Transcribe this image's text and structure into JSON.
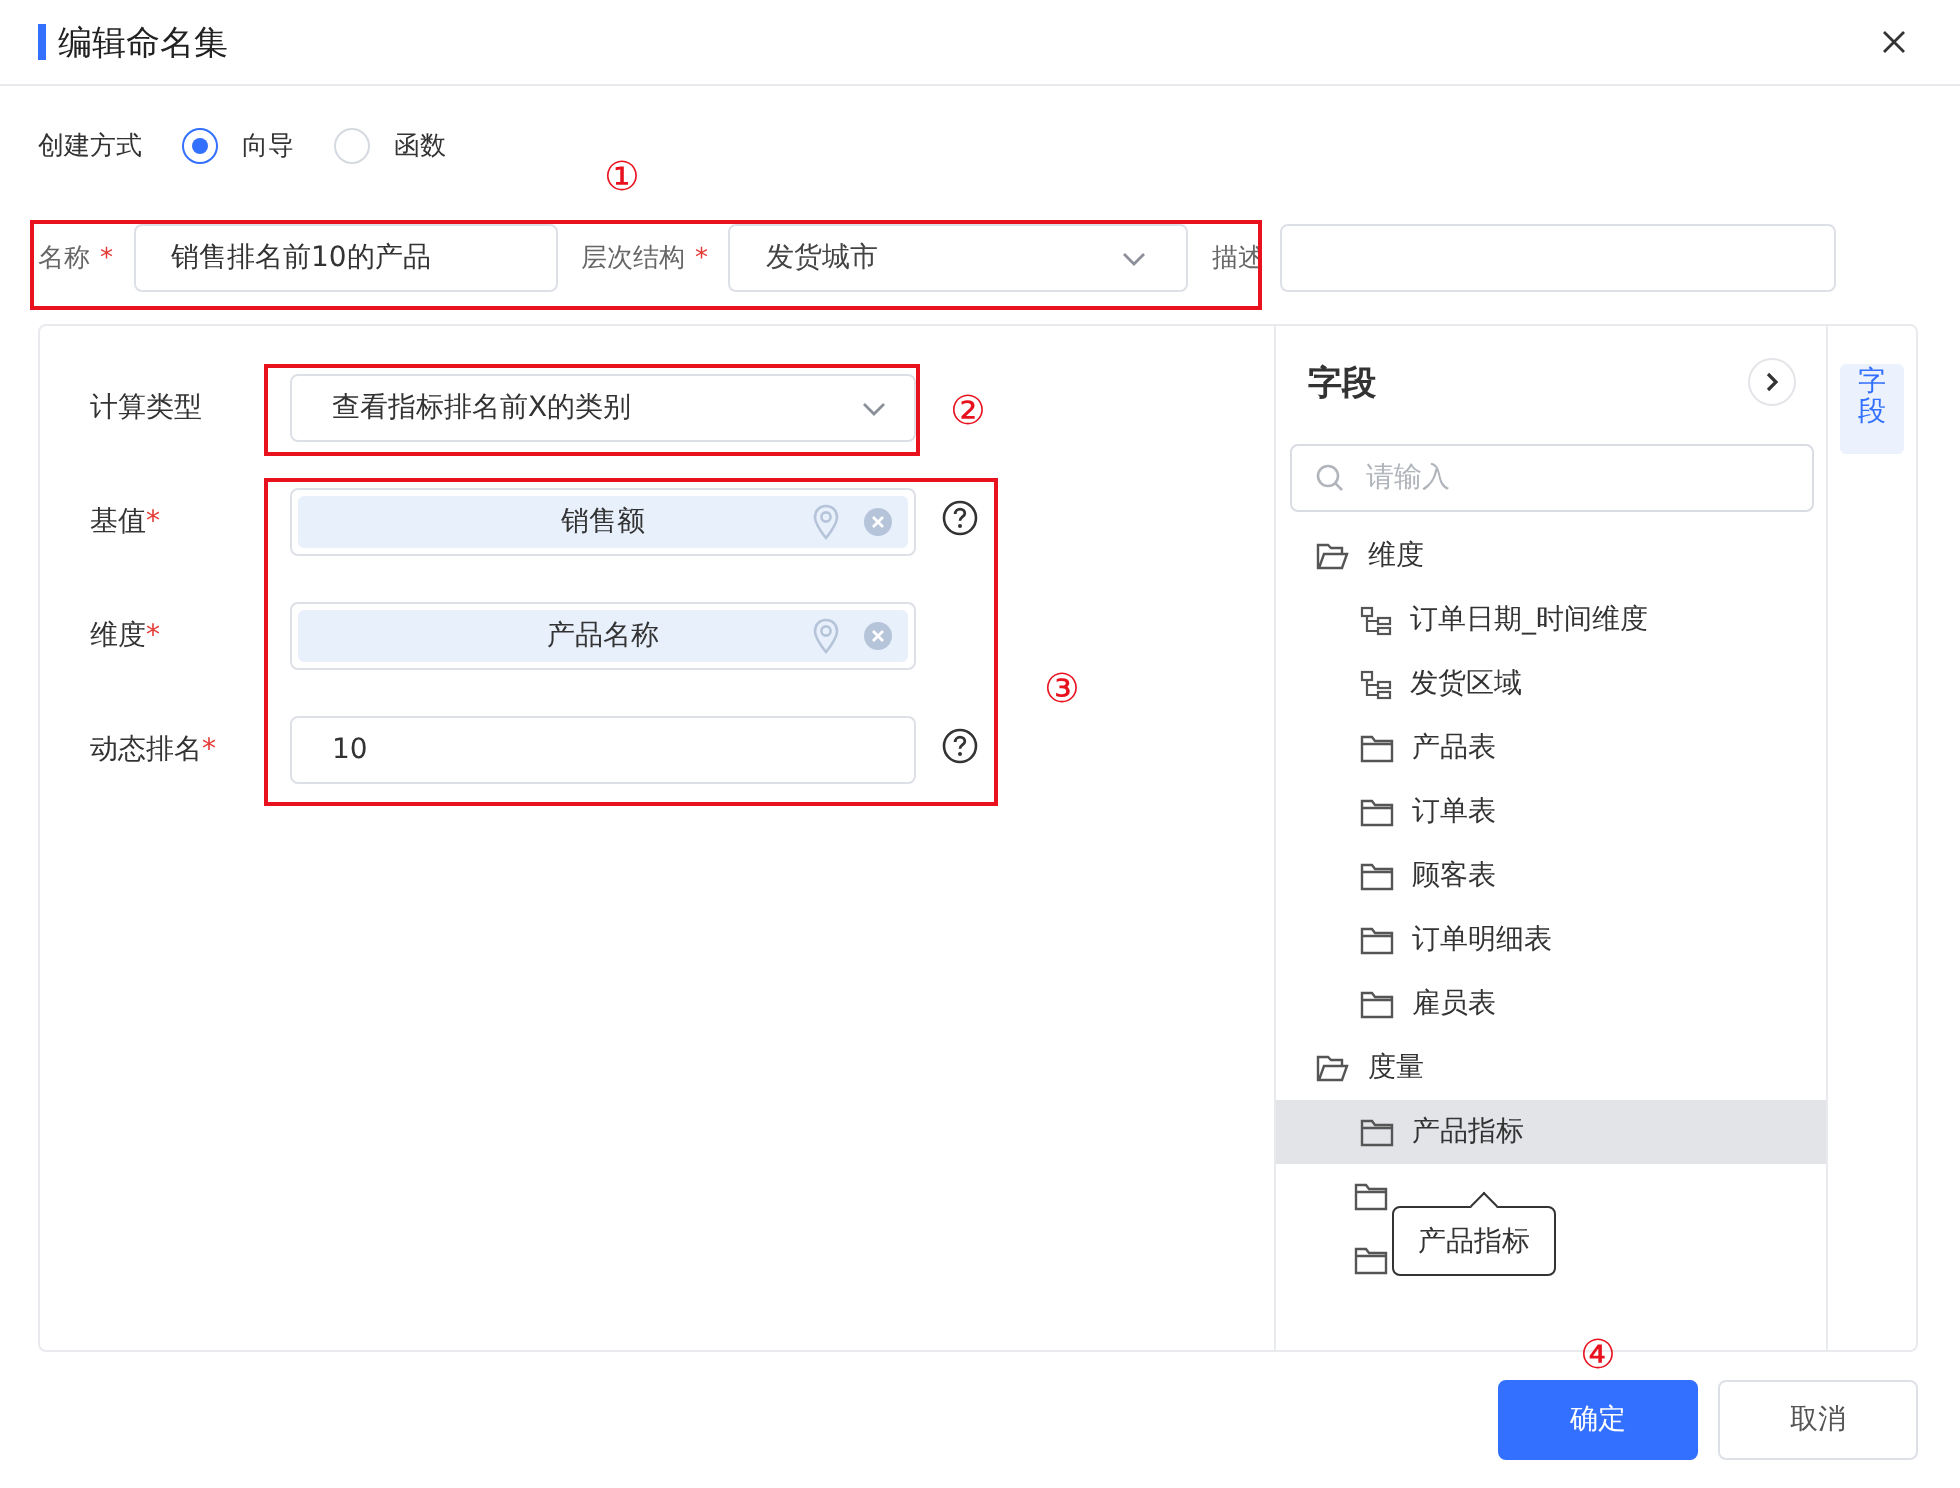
{
  "dialog": {
    "title": "编辑命名集"
  },
  "creation": {
    "label": "创建方式",
    "options": [
      {
        "label": "向导",
        "selected": true
      },
      {
        "label": "函数",
        "selected": false
      }
    ]
  },
  "name_row": [
    {
      "kind": "input",
      "label": "名称",
      "mark": "*",
      "value": "销售排名前10的产品"
    },
    {
      "kind": "select",
      "label": "层次结构",
      "mark": "*",
      "value": "发货城市"
    },
    {
      "kind": "input",
      "label": "描述"
    }
  ],
  "form": {
    "rows": [
      {
        "kind": "select",
        "label": "计算类型",
        "value": "查看指标排名前X的类别",
        "help": false
      },
      {
        "kind": "chip",
        "label": "基值",
        "mark": "*",
        "value": "销售额",
        "help": true
      },
      {
        "kind": "chip",
        "label": "维度",
        "mark": "*",
        "value": "产品名称",
        "help": false
      },
      {
        "kind": "input",
        "label": "动态排名",
        "mark": "*",
        "value": "10",
        "help": true
      }
    ]
  },
  "fields_panel": {
    "title": "字段",
    "search": {
      "placeholder": "请输入"
    },
    "tree": [
      {
        "kind": "folder",
        "label": "维度",
        "expanded": true,
        "selected": false,
        "children": [
          {
            "kind": "hierarchy",
            "label": "订单日期_时间维度",
            "selected": false
          },
          {
            "kind": "hierarchy",
            "label": "发货区域",
            "selected": false
          },
          {
            "kind": "folder",
            "label": "产品表",
            "expanded": false,
            "selected": false
          },
          {
            "kind": "folder",
            "label": "订单表",
            "expanded": false,
            "selected": false
          },
          {
            "kind": "folder",
            "label": "顾客表",
            "expanded": false,
            "selected": false
          },
          {
            "kind": "folder",
            "label": "订单明细表",
            "expanded": false,
            "selected": false
          },
          {
            "kind": "folder",
            "label": "雇员表",
            "expanded": false,
            "selected": false
          }
        ]
      },
      {
        "kind": "folder",
        "label": "度量",
        "expanded": true,
        "selected": false,
        "children": [
          {
            "kind": "folder",
            "label": "产品指标",
            "expanded": false,
            "selected": true
          },
          {
            "kind": "folder",
            "expanded": false,
            "selected": false
          },
          {
            "kind": "folder",
            "expanded": false,
            "selected": false
          }
        ]
      }
    ]
  },
  "side_tabs": [
    {
      "label": "字段",
      "selected": true
    }
  ],
  "tooltip": {
    "text": "产品指标"
  },
  "buttons": [
    {
      "label": "确定",
      "kind": "primary"
    },
    {
      "label": "取消",
      "kind": "default"
    }
  ],
  "annotations": [
    {
      "label": "①"
    },
    {
      "label": "②"
    },
    {
      "label": "③"
    },
    {
      "label": "④"
    }
  ]
}
